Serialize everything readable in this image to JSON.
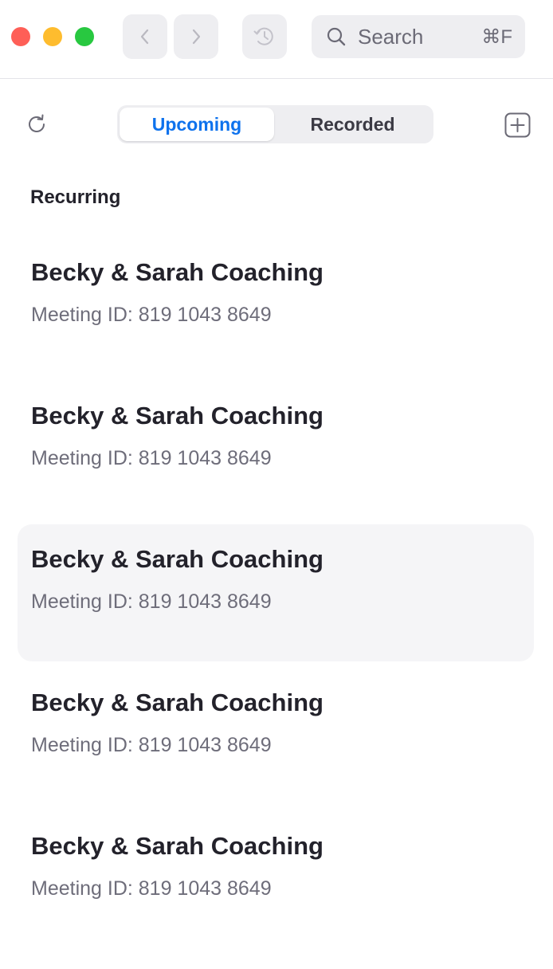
{
  "window": {
    "icons": {
      "close": "close-icon",
      "minimize": "minimize-icon",
      "zoom": "zoom-icon",
      "back": "chevron-left-icon",
      "forward": "chevron-right-icon",
      "history": "history-icon",
      "search": "search-icon",
      "refresh": "refresh-icon",
      "add": "add-square-icon"
    },
    "colors": {
      "close": "#fe5f57",
      "minimize": "#febc2e",
      "zoom": "#28c840",
      "accent": "#0e72ed"
    }
  },
  "search": {
    "placeholder": "Search",
    "shortcut": "⌘F"
  },
  "tabs": {
    "upcoming": "Upcoming",
    "recorded": "Recorded",
    "active": "Upcoming"
  },
  "section": {
    "title": "Recurring"
  },
  "meetings": [
    {
      "title": "Becky & Sarah Coaching",
      "meeting_id": "Meeting ID: 819 1043 8649"
    },
    {
      "title": "Becky & Sarah Coaching",
      "meeting_id": "Meeting ID: 819 1043 8649"
    },
    {
      "title": "Becky & Sarah Coaching",
      "meeting_id": "Meeting ID: 819 1043 8649",
      "selected": true
    },
    {
      "title": "Becky & Sarah Coaching",
      "meeting_id": "Meeting ID: 819 1043 8649"
    },
    {
      "title": "Becky & Sarah Coaching",
      "meeting_id": "Meeting ID: 819 1043 8649"
    }
  ]
}
